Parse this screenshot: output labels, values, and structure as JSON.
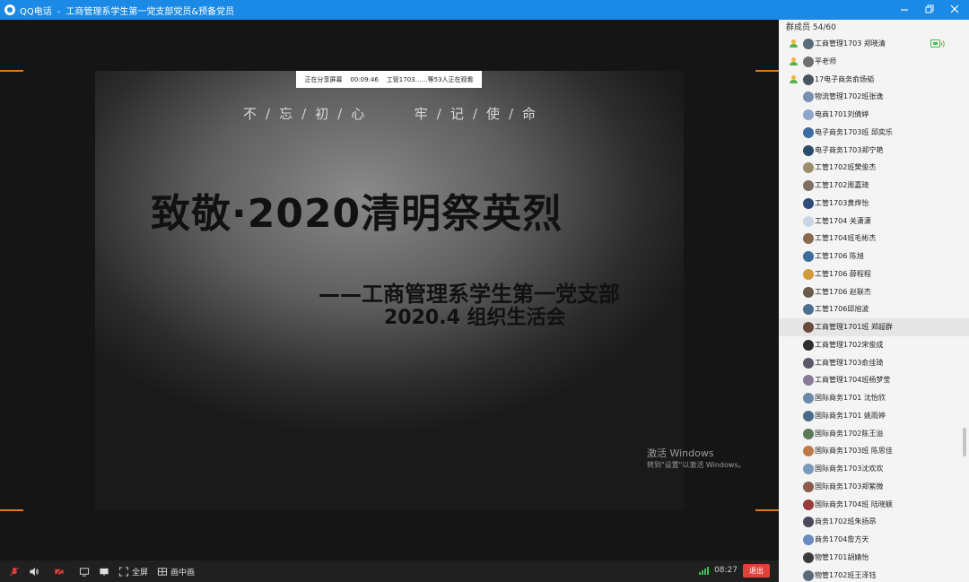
{
  "window": {
    "app_name": "QQ电话",
    "separator": "-",
    "group_name": "工商管理系学生第一党支部党员&预备党员",
    "minimize_icon": "minimize-icon",
    "restore_icon": "restore-icon",
    "close_icon": "close-icon"
  },
  "share_bar": {
    "status": "正在分享屏幕",
    "duration": "00:09:46",
    "viewers": "工管1703……等53人正在观看"
  },
  "slide": {
    "motto_left": [
      "不",
      "/",
      "忘",
      "/",
      "初",
      "/",
      "心"
    ],
    "motto_right": [
      "牢",
      "/",
      "记",
      "/",
      "使",
      "/",
      "命"
    ],
    "headline": "致敬·2020清明祭英烈",
    "subtitle_line1": "——工商管理系学生第一党支部",
    "subtitle_line2": "2020.4 组织生活会"
  },
  "watermark": {
    "line1": "激活 Windows",
    "line2": "转到\"设置\"以激活 Windows。"
  },
  "bottom_bar": {
    "mic_icon": "mic-muted-icon",
    "speaker_icon": "speaker-icon",
    "camera_icon": "camera-off-icon",
    "screen_icon": "screen-share-icon",
    "whiteboard_icon": "whiteboard-icon",
    "fullscreen_label": "全屏",
    "pip_label": "画中画",
    "timer": "08:27",
    "exit_label": "退出",
    "accent_red": "#e0423a",
    "signal_color": "#3cc24f"
  },
  "panel": {
    "header": "群成员 54/60",
    "members": [
      {
        "name": "工商管理1703 郑晓清",
        "role": true,
        "speaking": true,
        "avatar_color": "#5a6b7a"
      },
      {
        "name": "平老师",
        "role": true,
        "avatar_color": "#6f6f6f"
      },
      {
        "name": "17电子商务俞炀韬",
        "role": true,
        "avatar_color": "#4a5560"
      },
      {
        "name": "物流管理1702班张逸",
        "avatar_color": "#7a8fb0"
      },
      {
        "name": "电商1701刘倩婷",
        "avatar_color": "#8ea6c9"
      },
      {
        "name": "电子商务1703班 邱奕乐",
        "avatar_color": "#3d6c9e"
      },
      {
        "name": "电子商务1703郑宁艳",
        "avatar_color": "#2b4b6a"
      },
      {
        "name": "工管1702班樊俊杰",
        "avatar_color": "#9a8d6a"
      },
      {
        "name": "工管1702周嘉琦",
        "avatar_color": "#7d7064"
      },
      {
        "name": "工管1703黄烨怡",
        "avatar_color": "#2f4b7a"
      },
      {
        "name": "工管1704 关潇潇",
        "avatar_color": "#c9d6e3"
      },
      {
        "name": "工管1704班毛彬杰",
        "avatar_color": "#8a6a4f"
      },
      {
        "name": "工管1706 陈旭",
        "avatar_color": "#3a6e9a"
      },
      {
        "name": "工管1706 薛程程",
        "avatar_color": "#d19a3a"
      },
      {
        "name": "工管1706 赵联杰",
        "avatar_color": "#6a5a4a"
      },
      {
        "name": "工管1706邱旭波",
        "avatar_color": "#4f6f8f"
      },
      {
        "name": "工商管理1701班 郑超群",
        "highlight": true,
        "avatar_color": "#6a4a3a"
      },
      {
        "name": "工商管理1702宋俊成",
        "avatar_color": "#2e2e2e"
      },
      {
        "name": "工商管理1703俞佳琦",
        "avatar_color": "#5a5a6a"
      },
      {
        "name": "工商管理1704班杨梦莹",
        "avatar_color": "#8a7a9a"
      },
      {
        "name": "国际商务1701 沈怡欣",
        "avatar_color": "#6a8aaa"
      },
      {
        "name": "国际商务1701 姚雨婷",
        "avatar_color": "#4a6a8a"
      },
      {
        "name": "国际商务1702陈王溢",
        "avatar_color": "#5a7a5a"
      },
      {
        "name": "国际商务1703班 陈思佳",
        "avatar_color": "#c07a4a"
      },
      {
        "name": "国际商务1703沈欢欢",
        "avatar_color": "#7a9aba"
      },
      {
        "name": "国际商务1703郑紫微",
        "avatar_color": "#8a5a4a"
      },
      {
        "name": "国际商务1704班 陆晓颖",
        "avatar_color": "#9a3a3a"
      },
      {
        "name": "商务1702班朱扬昂",
        "avatar_color": "#4a4a5a"
      },
      {
        "name": "商务1704詹方天",
        "avatar_color": "#6a8ac0"
      },
      {
        "name": "物管1701胡婧怡",
        "avatar_color": "#3a3a3a"
      },
      {
        "name": "物管1702班王泽钰",
        "avatar_color": "#5a6a7a"
      }
    ]
  }
}
